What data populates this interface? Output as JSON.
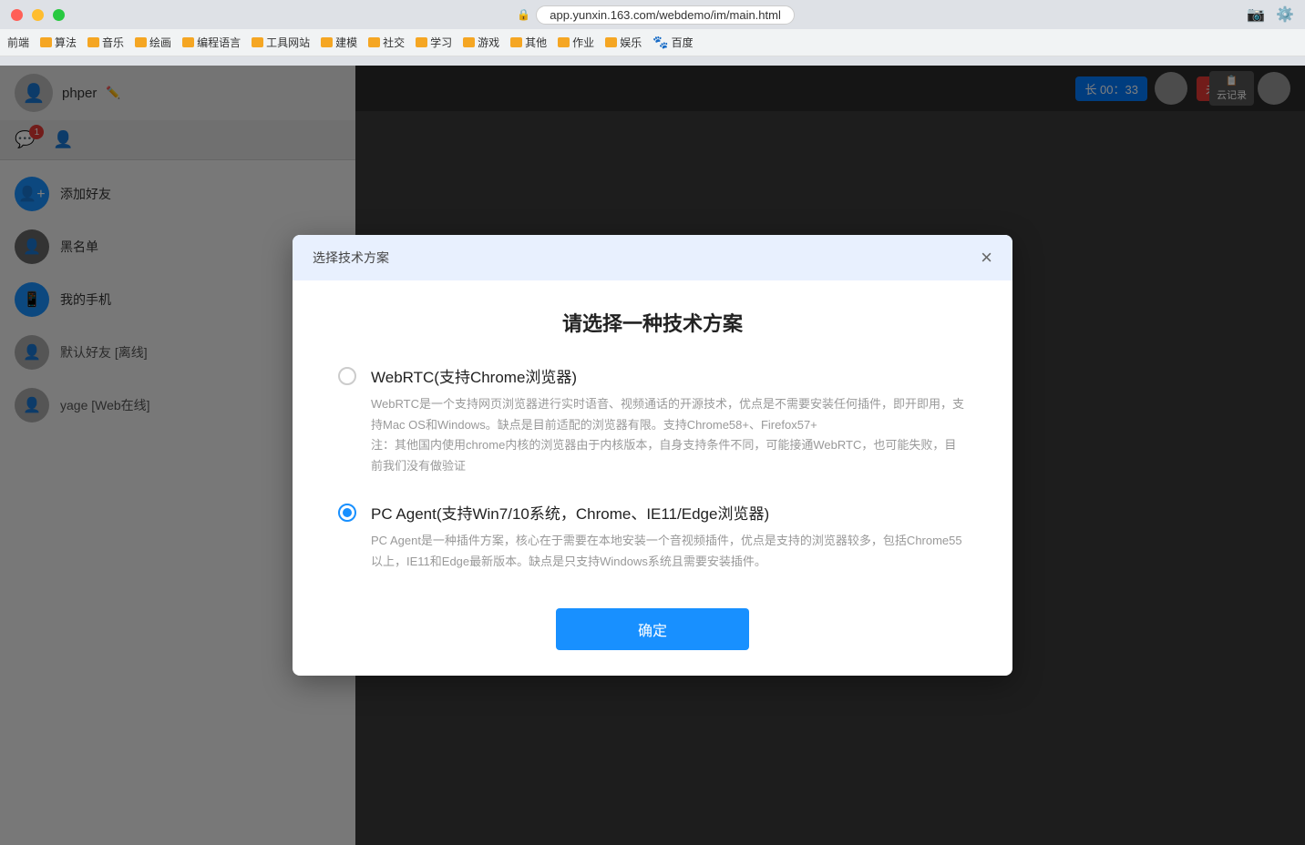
{
  "browser": {
    "url": "app.yunxin.163.com/webdemo/im/main.html",
    "lock_symbol": "🔒"
  },
  "bookmarks": [
    {
      "label": "前端",
      "color": "default"
    },
    {
      "label": "算法",
      "color": "orange"
    },
    {
      "label": "音乐",
      "color": "orange"
    },
    {
      "label": "绘画",
      "color": "orange"
    },
    {
      "label": "编程语言",
      "color": "orange"
    },
    {
      "label": "工具网站",
      "color": "orange"
    },
    {
      "label": "建模",
      "color": "orange"
    },
    {
      "label": "社交",
      "color": "orange"
    },
    {
      "label": "学习",
      "color": "orange"
    },
    {
      "label": "游戏",
      "color": "orange"
    },
    {
      "label": "其他",
      "color": "orange"
    },
    {
      "label": "作业",
      "color": "orange"
    },
    {
      "label": "娱乐",
      "color": "orange"
    },
    {
      "label": "百度",
      "color": "blue"
    }
  ],
  "sidebar": {
    "username": "phper",
    "message_badge": "1",
    "items": [
      {
        "label": "添加好友",
        "type": "action",
        "avatar_type": "blue"
      },
      {
        "label": "黑名单",
        "type": "action",
        "avatar_type": "dark"
      },
      {
        "label": "我的手机",
        "type": "action",
        "avatar_type": "blue"
      },
      {
        "label": "默认好友 [离线]",
        "type": "contact",
        "avatar_type": "gray"
      },
      {
        "label": "yage [Web在线]",
        "type": "contact",
        "avatar_type": "gray"
      }
    ]
  },
  "call": {
    "timer": "长 00：33",
    "status_label": "未接通",
    "yunjilu_label": "云记录"
  },
  "modal": {
    "header_title": "选择技术方案",
    "close_label": "×",
    "heading": "请选择一种技术方案",
    "confirm_label": "确定",
    "options": [
      {
        "id": "webrtc",
        "title": "WebRTC(支持Chrome浏览器)",
        "desc": "WebRTC是一个支持网页浏览器进行实时语音、视频通话的开源技术，优点是不需要安装任何插件，即开即用，支持Mac OS和Windows。缺点是目前适配的浏览器有限。支持Chrome58+、Firefox57+\n注：其他国内使用chrome内核的浏览器由于内核版本，自身支持条件不同，可能接通WebRTC，也可能失败，目前我们没有做验证",
        "selected": false
      },
      {
        "id": "pc-agent",
        "title": "PC Agent(支持Win7/10系统，Chrome、IE11/Edge浏览器)",
        "desc": "PC Agent是一种插件方案，核心在于需要在本地安装一个音视频插件，优点是支持的浏览器较多，包括Chrome55以上，IE11和Edge最新版本。缺点是只支持Windows系统且需要安装插件。",
        "selected": true
      }
    ]
  }
}
